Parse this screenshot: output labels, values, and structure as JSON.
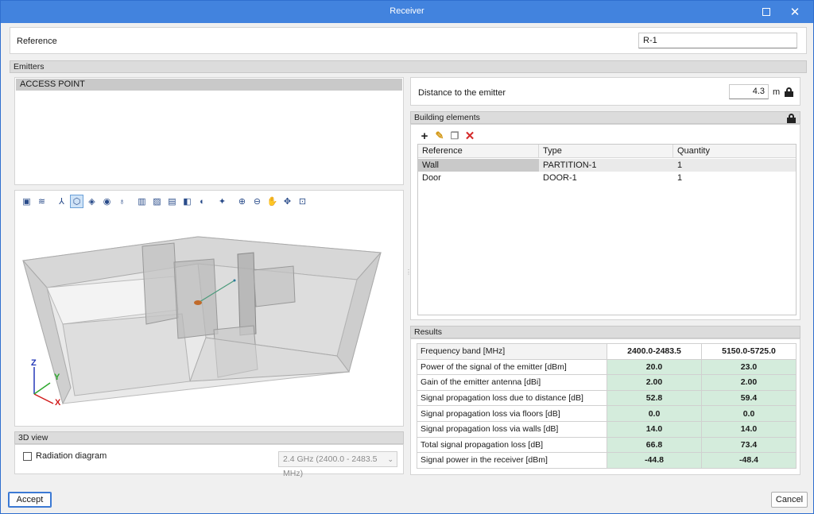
{
  "window": {
    "title": "Receiver"
  },
  "reference": {
    "label": "Reference",
    "value": "R-1"
  },
  "emitters": {
    "header": "Emitters",
    "items": [
      "ACCESS POINT"
    ]
  },
  "view3d": {
    "header": "3D view",
    "radiation_label": "Radiation diagram",
    "radiation_checked": false,
    "frequency_option": "2.4 GHz (2400.0 - 2483.5 MHz)",
    "axes": {
      "x": "X",
      "y": "Y",
      "z": "Z"
    },
    "axis_colors": {
      "x": "#d11d1d",
      "y": "#2da82d",
      "z": "#2438b8"
    }
  },
  "distance": {
    "label": "Distance to the emitter",
    "value": "4.3",
    "unit": "m"
  },
  "building": {
    "header": "Building elements",
    "columns": [
      "Reference",
      "Type",
      "Quantity"
    ],
    "rows": [
      {
        "reference": "Wall",
        "type": "PARTITION-1",
        "quantity": "1"
      },
      {
        "reference": "Door",
        "type": "DOOR-1",
        "quantity": "1"
      }
    ]
  },
  "results": {
    "header": "Results",
    "column_label": "Frequency band [MHz]",
    "bands": [
      "2400.0-2483.5",
      "5150.0-5725.0"
    ],
    "rows": [
      {
        "label": "Power of the signal of the emitter [dBm]",
        "values": [
          "20.0",
          "23.0"
        ]
      },
      {
        "label": "Gain of the emitter antenna [dBi]",
        "values": [
          "2.00",
          "2.00"
        ]
      },
      {
        "label": "Signal propagation loss due to distance [dB]",
        "values": [
          "52.8",
          "59.4"
        ]
      },
      {
        "label": "Signal propagation loss via floors [dB]",
        "values": [
          "0.0",
          "0.0"
        ]
      },
      {
        "label": "Signal propagation loss via walls [dB]",
        "values": [
          "14.0",
          "14.0"
        ]
      },
      {
        "label": "Total signal propagation loss [dB]",
        "values": [
          "66.8",
          "73.4"
        ]
      },
      {
        "label": "Signal power in the receiver [dBm]",
        "values": [
          "-44.8",
          "-48.4"
        ]
      }
    ],
    "value_bg": "#d4ecdc"
  },
  "buttons": {
    "accept": "Accept",
    "cancel": "Cancel"
  }
}
